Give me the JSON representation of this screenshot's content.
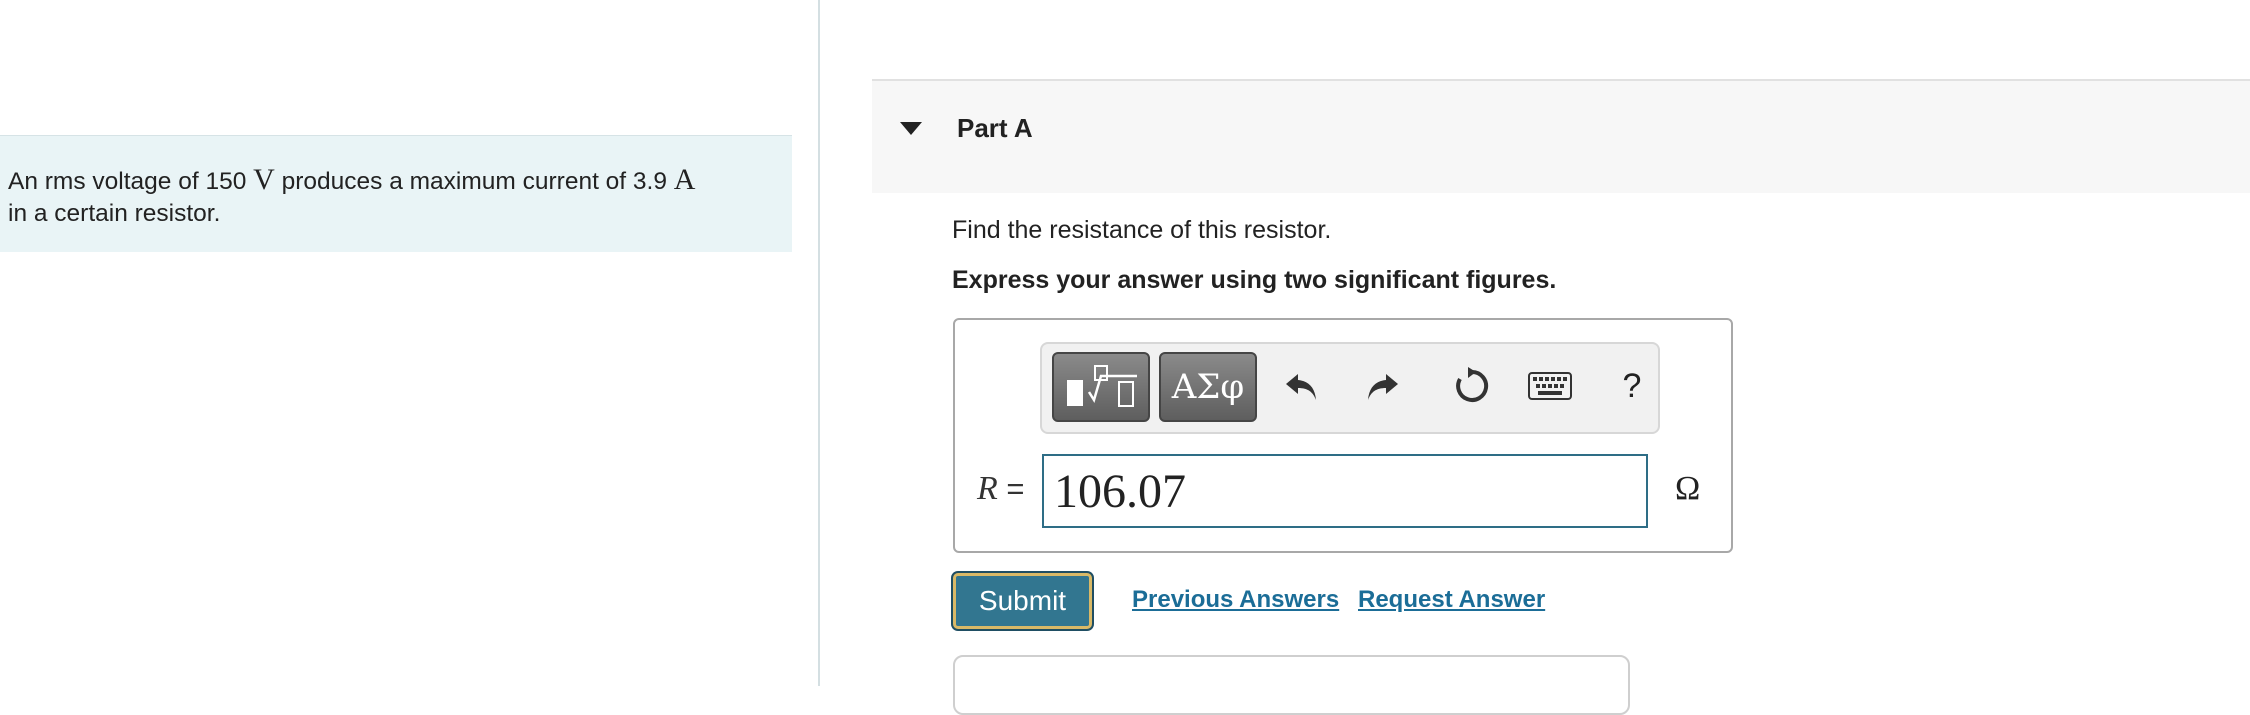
{
  "problem": {
    "text_1": "An rms voltage of 150 ",
    "unit_v": "V",
    "text_2": " produces a maximum current of 3.9 ",
    "unit_a": "A",
    "text_3": "in a certain resistor."
  },
  "part": {
    "title": "Part A",
    "instruction": "Find the resistance of this resistor.",
    "emphasis": "Express your answer using two significant figures."
  },
  "toolbar": {
    "greek_label": "ΑΣφ",
    "help_label": "?"
  },
  "answer": {
    "variable": "R",
    "equals": " =",
    "value": "106.07",
    "unit": "Ω"
  },
  "actions": {
    "submit_label": "Submit",
    "previous_answers_label": "Previous Answers",
    "request_answer_label": "Request Answer"
  },
  "colors": {
    "problem_bg": "#e9f4f6",
    "submit_bg": "#327690",
    "link": "#1b6d97"
  }
}
